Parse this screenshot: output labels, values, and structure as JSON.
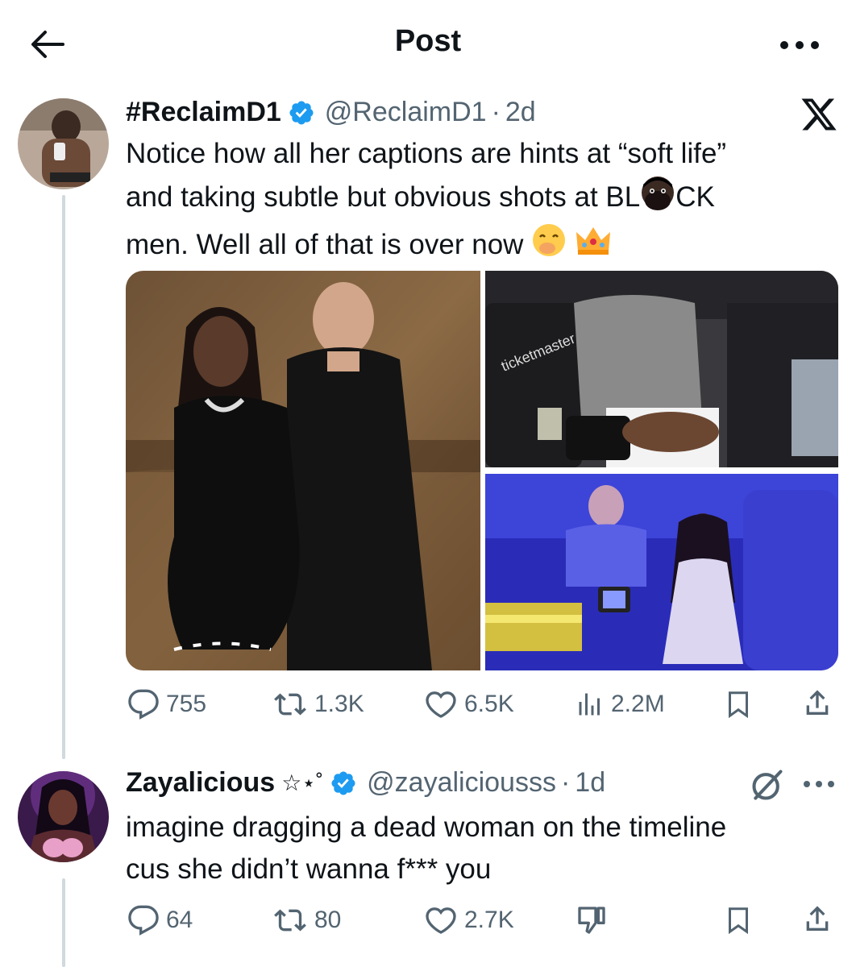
{
  "header": {
    "title": "Post"
  },
  "tweet": {
    "name": "#ReclaimD1",
    "handle": "@ReclaimD1",
    "time": "2d",
    "text_line1": "Notice how all her captions are hints at “soft life”",
    "text_line2_a": "and taking subtle but obvious shots at BL",
    "text_line2_b": "CK",
    "text_line3": "men. Well all of that is over now",
    "stats": {
      "replies": "755",
      "reposts": "1.3K",
      "likes": "6.5K",
      "views": "2.2M"
    },
    "media_labels": {
      "ticketmaster": "ticketmaster"
    }
  },
  "reply": {
    "name": "Zayalicious",
    "name_decoration": "☆⋆˚",
    "handle": "@zayaliciousss",
    "time": "1d",
    "text_line1": "imagine dragging a dead woman on the timeline",
    "text_line2": "cus she didn’t wanna f*** you",
    "stats": {
      "replies": "64",
      "reposts": "80",
      "likes": "2.7K"
    }
  },
  "colors": {
    "text": "#0f1419",
    "secondary": "#536471",
    "verified": "#1d9bf0",
    "thread_line": "#cfd9de"
  },
  "icons": [
    "back-arrow-icon",
    "more-horizontal-icon",
    "verified-badge-icon",
    "x-logo-icon",
    "reply-icon",
    "repost-icon",
    "like-icon",
    "views-icon",
    "bookmark-icon",
    "share-icon",
    "grok-icon",
    "dislike-icon"
  ]
}
